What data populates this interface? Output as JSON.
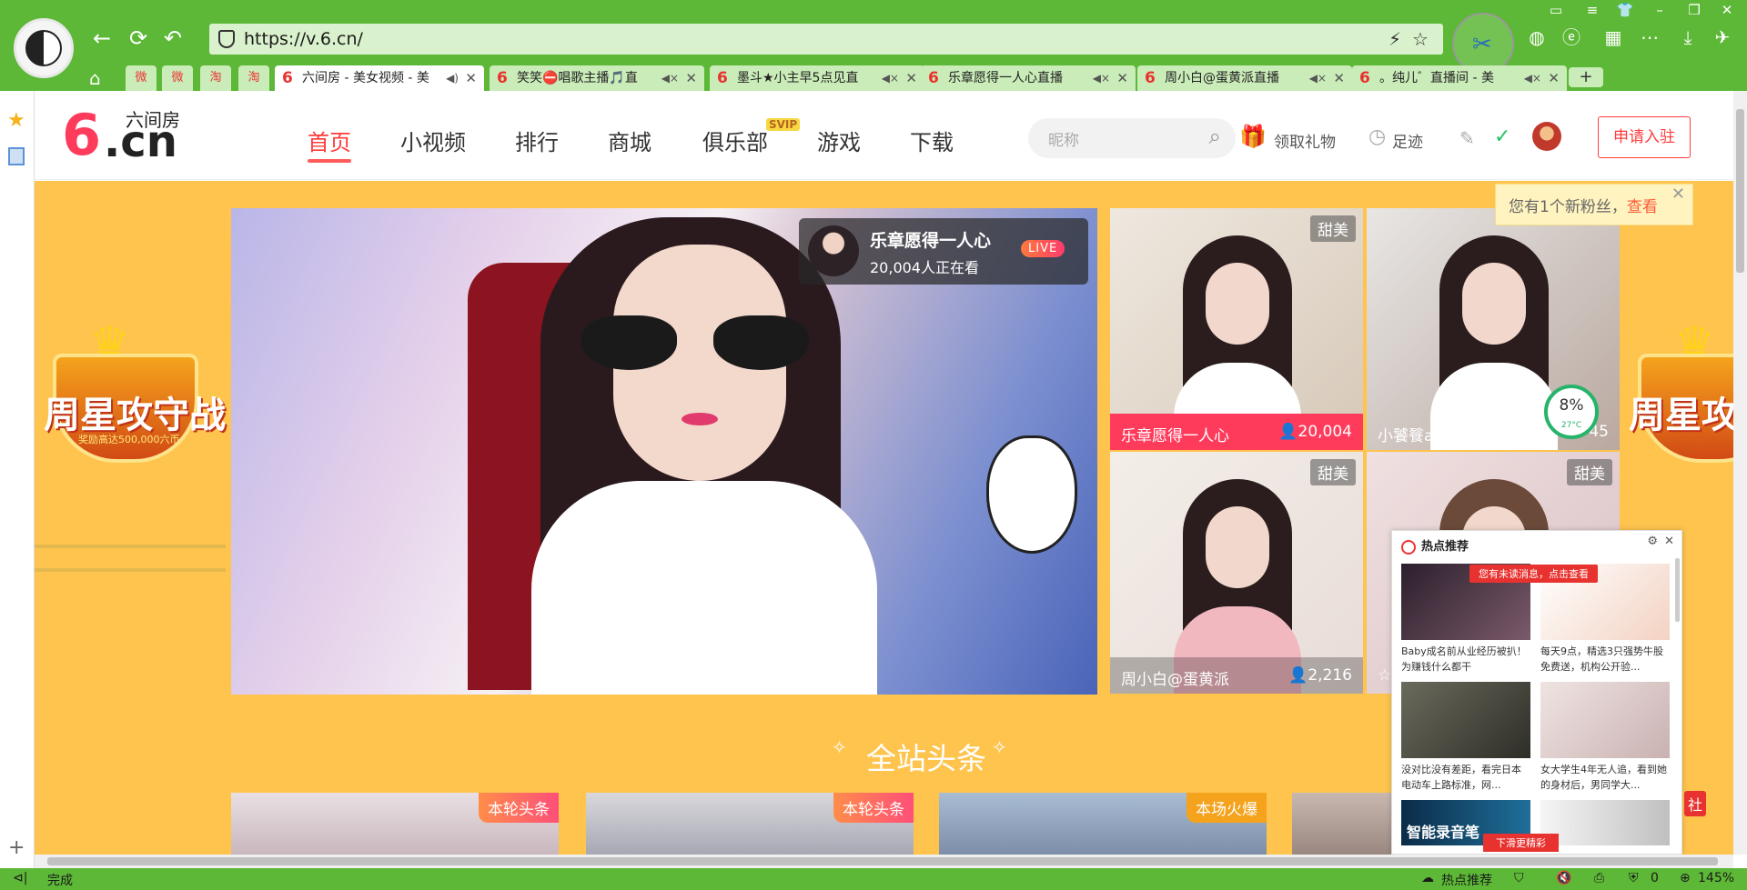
{
  "browser": {
    "url": "https://v.6.cn/",
    "tabs": [
      {
        "title": "六间房 - 美女视频 - 美",
        "active": true
      },
      {
        "title": "笑笑⛔唱歌主播🎵直",
        "active": false
      },
      {
        "title": "墨斗★小主早5点见直",
        "active": false
      },
      {
        "title": "乐章愿得一人心直播",
        "active": false
      },
      {
        "title": "周小白@蛋黄派直播",
        "active": false
      },
      {
        "title": "。纯儿゛直播间 - 美",
        "active": false
      }
    ],
    "mini_tabs": [
      "微",
      "微",
      "淘",
      "淘"
    ],
    "status_left": "完成",
    "status_hot": "热点推荐",
    "status_zero": "0",
    "zoom": "145%"
  },
  "site": {
    "logo_text": "六间房",
    "logo_six": "6",
    "logo_cn": ".cn",
    "nav": [
      {
        "label": "首页",
        "active": true
      },
      {
        "label": "小视频"
      },
      {
        "label": "排行"
      },
      {
        "label": "商城"
      },
      {
        "label": "俱乐部"
      },
      {
        "label": "游戏"
      },
      {
        "label": "下载"
      }
    ],
    "svip_badge": "SVIP",
    "search_placeholder": "昵称",
    "gift": "领取礼物",
    "footprint": "足迹",
    "apply": "申请入驻"
  },
  "notice": {
    "text": "您有1个新粉丝，",
    "link": "查看"
  },
  "banner": {
    "title": "周星攻守战",
    "sub": "奖励高达500,000六币"
  },
  "main_live": {
    "name": "乐章愿得一人心",
    "viewers": "20,004人正在看",
    "badge": "LIVE"
  },
  "thumbnails": [
    {
      "tag": "甜美",
      "name": "乐章愿得一人心",
      "count": "20,004",
      "cap_color": "#ff3b5c"
    },
    {
      "tag": "",
      "name": "小饕餮a",
      "count": "45",
      "cap_color": ""
    },
    {
      "tag": "甜美",
      "name": "周小白@蛋黄派",
      "count": "2,216",
      "cap_color": ""
    },
    {
      "tag": "甜美",
      "name": "☆",
      "count": "",
      "cap_color": ""
    }
  ],
  "gauge": {
    "value": "8",
    "unit": "%",
    "temp": "27°C"
  },
  "headline": {
    "title": "全站头条",
    "cards": [
      {
        "badge": "本轮头条"
      },
      {
        "badge": "本轮头条"
      },
      {
        "badge": "本场火爆"
      },
      {
        "badge": ""
      }
    ]
  },
  "hot_popup": {
    "title": "热点推荐",
    "unread": "您有未读消息，点击查看",
    "items": [
      {
        "text": "Baby成名前从业经历被扒！为赚钱什么都干",
        "color": "#3a2a3a"
      },
      {
        "text": "每天9点，精选3只强势牛股免费送，机构公开验...",
        "color": "#f3e6d2"
      },
      {
        "text": "没对比没有差距，看完日本电动车上路标准，网...",
        "color": "#5a5a4e"
      },
      {
        "text": "女大学生4年无人追，看到她的身材后，男同学大...",
        "color": "#d9c6c6"
      }
    ],
    "bottom_left": "智能录音笔",
    "more": "下滑更精彩"
  },
  "right_partial": "社"
}
